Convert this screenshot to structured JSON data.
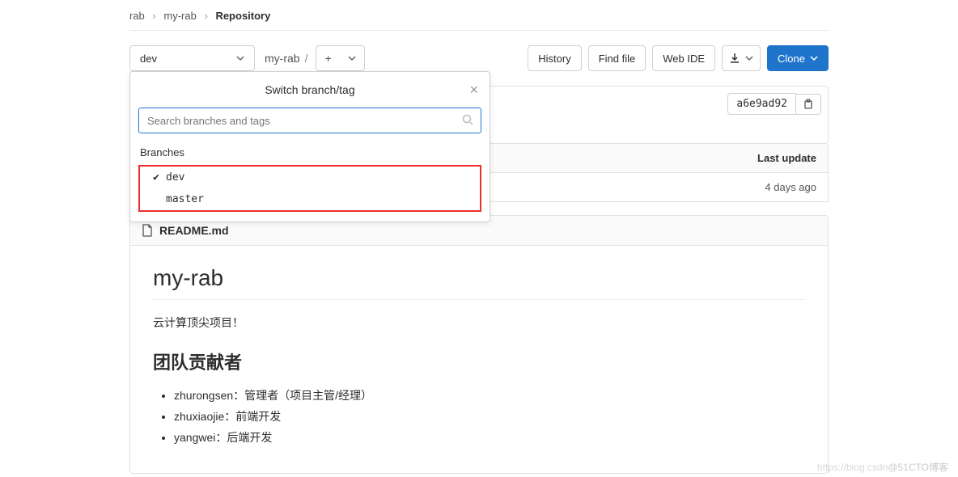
{
  "breadcrumb": {
    "root": "rab",
    "project": "my-rab",
    "page": "Repository"
  },
  "toolbar": {
    "branch": "dev",
    "project_name": "my-rab",
    "history": "History",
    "find_file": "Find file",
    "web_ide": "Web IDE",
    "clone": "Clone"
  },
  "dropdown": {
    "title": "Switch branch/tag",
    "search_placeholder": "Search branches and tags",
    "section_label": "Branches",
    "items": [
      {
        "name": "dev",
        "selected": true
      },
      {
        "name": "master",
        "selected": false
      }
    ]
  },
  "commit": {
    "sha": "a6e9ad92"
  },
  "table": {
    "header_last": "Last update",
    "row_time": "4 days ago"
  },
  "readme": {
    "filename": "README.md",
    "title": "my-rab",
    "tagline": "云计算顶尖项目！",
    "contrib_heading": "团队贡献者",
    "contributors": [
      "zhurongsen：管理者（项目主管/经理）",
      "zhuxiaojie：前端开发",
      "yangwei：后端开发"
    ]
  },
  "watermark": "@51CTO博客"
}
